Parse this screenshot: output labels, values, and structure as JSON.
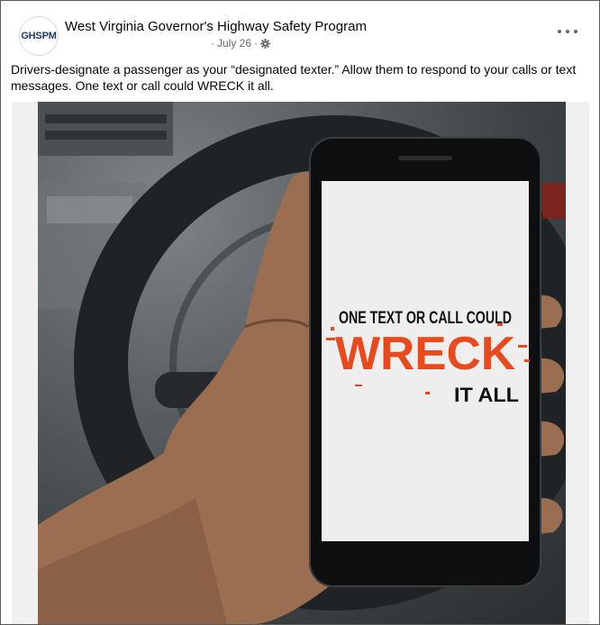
{
  "post": {
    "page_name": "West Virginia Governor's Highway Safety Program",
    "avatar_text": "GHSPM",
    "date": "July 26",
    "separator": "·",
    "text": "Drivers-designate a passenger as your “designated texter.” Allow them to respond to your calls or text messages. One text or call could WRECK it all."
  },
  "image": {
    "line1": "ONE TEXT OR CALL COULD",
    "line2": "WRECK",
    "line3": "IT ALL",
    "accent_color": "#e8491d"
  },
  "icons": {
    "privacy": "gear-icon",
    "more": "more-options-icon"
  }
}
